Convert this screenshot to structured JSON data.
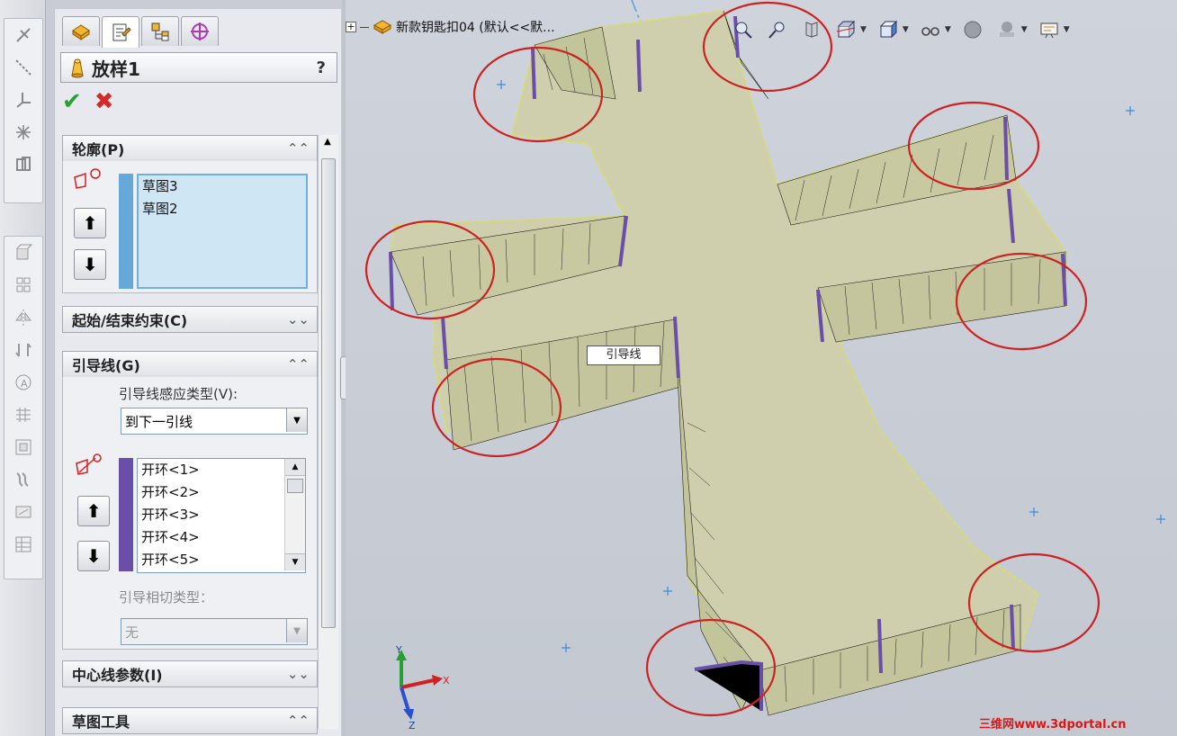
{
  "left_toolbar": {
    "top_icons": [
      "sketch-entity-icon",
      "centerline-icon",
      "coordinate-system-icon",
      "point-icon",
      "reference-plane-icon"
    ],
    "bottom_icons": [
      "extrude-icon",
      "pattern-icon",
      "mirror-icon",
      "move-copy-icon",
      "text-icon",
      "grid-icon",
      "shell-icon",
      "wrap-icon",
      "split-line-icon",
      "table-icon"
    ]
  },
  "pm": {
    "tabs": [
      "feature-manager",
      "property-manager",
      "configuration-manager",
      "dimxpert-manager"
    ],
    "title": "放样1",
    "help": "?",
    "sections": {
      "profiles": {
        "title": "轮廓(P)",
        "items": [
          "草图3",
          "草图2"
        ],
        "up": "⬆",
        "down": "⬇",
        "chevron": "⌃⌃"
      },
      "start_end": {
        "title": "起始/结束约束(C)",
        "chevron": "⌄⌄"
      },
      "guides": {
        "title": "引导线(G)",
        "chevron": "⌃⌃",
        "influence_label": "引导线感应类型(V):",
        "influence_value": "到下一引线",
        "items": [
          "开环<1>",
          "开环<2>",
          "开环<3>",
          "开环<4>",
          "开环<5>"
        ],
        "tangency_label": "引导相切类型：",
        "tangency_value": "无",
        "up": "⬆",
        "down": "⬇"
      },
      "centerline": {
        "title": "中心线参数(I)",
        "chevron": "⌄⌄"
      },
      "sketch_tools": {
        "title": "草图工具",
        "chevron": "⌃⌃"
      }
    }
  },
  "viewport": {
    "tree_label": "新款钥匙扣04 (默认<<默...",
    "leader_tag": "引导线",
    "watermark": "三维网www.3dportal.cn",
    "axes": {
      "x": "X",
      "y": "Y",
      "z": "Z"
    },
    "heads_up_icons": [
      "zoom-to-fit-icon",
      "zoom-area-icon",
      "previous-view-icon",
      "section-view-icon",
      "view-orientation-icon",
      "display-style-icon",
      "hide-show-icon",
      "edit-appearance-icon",
      "apply-scene-icon",
      "view-settings-icon"
    ]
  },
  "colors": {
    "accent_red": "#d62828",
    "surface": "#cfcfad",
    "profile": "#6a4fa8",
    "highlight_circle": "#cc2222"
  }
}
